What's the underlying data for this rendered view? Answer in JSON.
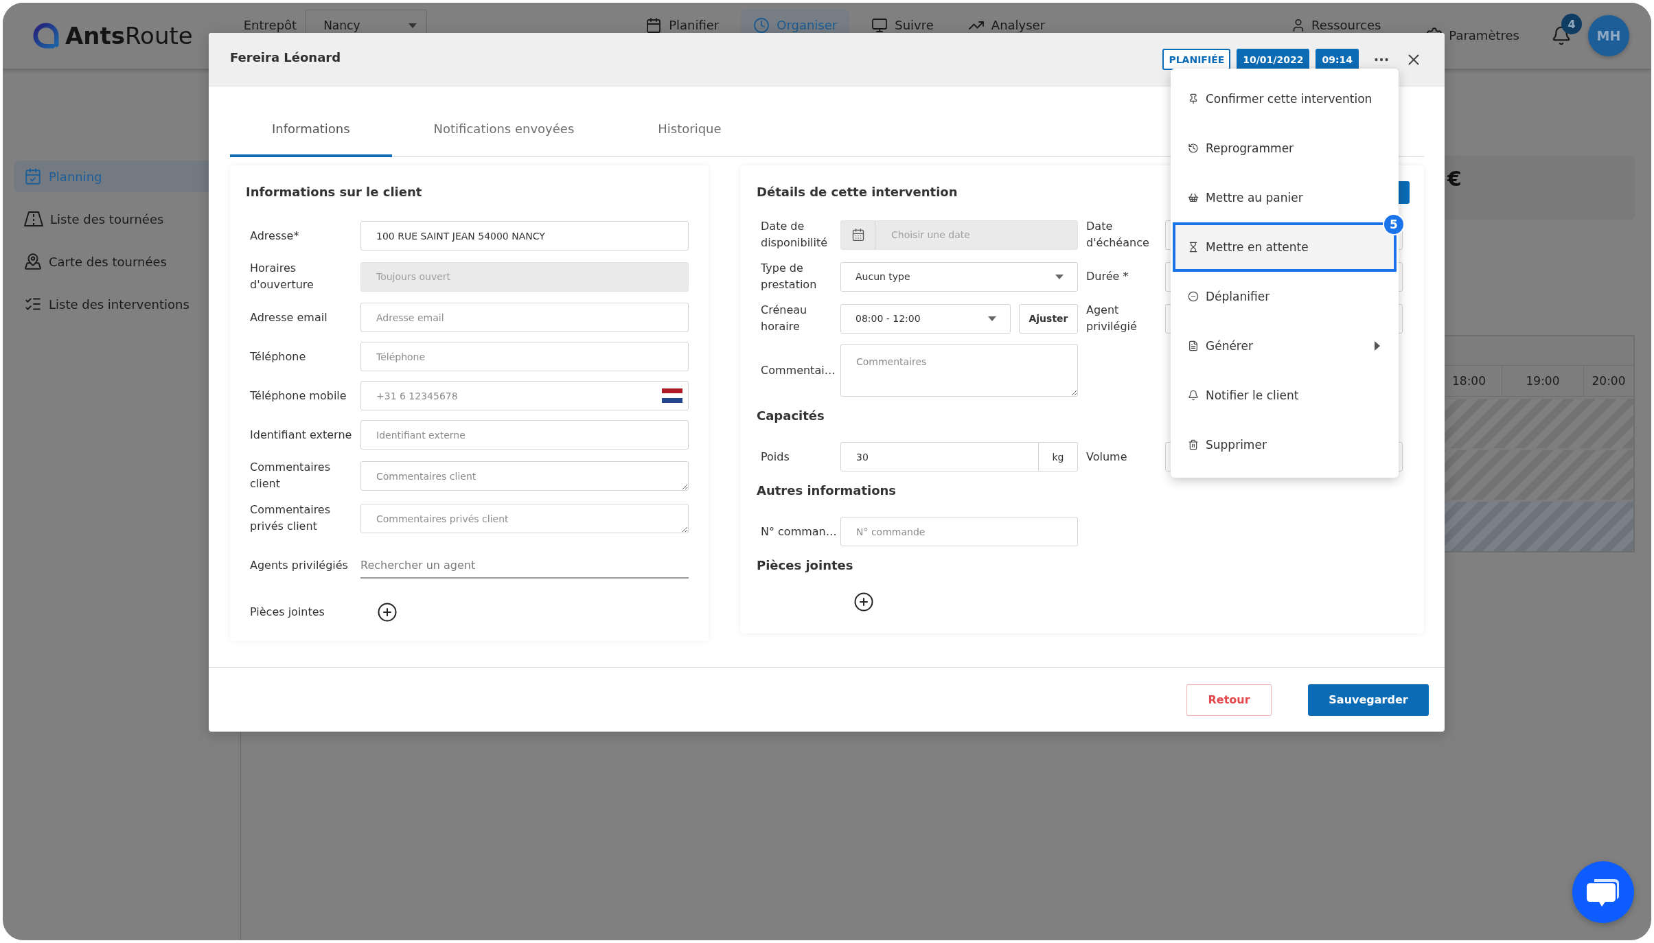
{
  "header": {
    "logo": "**Ants**Route",
    "warehouse_label": "Entrepôt",
    "warehouse_value": "Nancy",
    "nav": [
      {
        "label": "Planifier",
        "selected": false
      },
      {
        "label": "Organiser",
        "selected": true
      },
      {
        "label": "Suivre",
        "selected": false
      },
      {
        "label": "Analyser",
        "selected": false
      }
    ],
    "resources": "Ressources",
    "settings": "Paramètres",
    "notification_count": "4",
    "avatar": "MH"
  },
  "sidebar": {
    "items": [
      {
        "label": "Planning",
        "selected": true
      },
      {
        "label": "Liste des tournées",
        "selected": false
      },
      {
        "label": "Carte des tournées",
        "selected": false
      },
      {
        "label": "Liste des interventions",
        "selected": false
      }
    ]
  },
  "main": {
    "summary_card": {
      "currency": "€"
    },
    "timeline": {
      "hours": [
        "18:00",
        "19:00",
        "20:00"
      ]
    }
  },
  "dialog": {
    "title": "Fereira Léonard",
    "status": "PLANIFIÉE",
    "date": "10/01/2022",
    "time": "09:14",
    "tabs": [
      {
        "label": "Informations",
        "selected": true
      },
      {
        "label": "Notifications envoyées",
        "selected": false
      },
      {
        "label": "Historique",
        "selected": false
      }
    ],
    "client_card": {
      "title": "Informations sur le client",
      "fields": [
        {
          "kind": "input",
          "label": "Adresse*",
          "value": "100 RUE SAINT JEAN 54000 NANCY",
          "disabled": false
        },
        {
          "kind": "input",
          "label": "Horaires d'ouverture",
          "placeholder": "Toujours ouvert",
          "disabled": true
        },
        {
          "kind": "input",
          "label": "Adresse email",
          "placeholder": "Adresse email",
          "disabled": false
        },
        {
          "kind": "input",
          "label": "Téléphone",
          "placeholder": "Téléphone",
          "disabled": false
        },
        {
          "kind": "phone",
          "label": "Téléphone mobile",
          "placeholder": "+31 6 12345678",
          "disabled": false
        },
        {
          "kind": "input",
          "label": "Identifiant externe",
          "placeholder": "Identifiant externe",
          "disabled": false
        },
        {
          "kind": "textarea",
          "label": "Commentaires client",
          "placeholder": "Commentaires client",
          "disabled": false
        },
        {
          "kind": "textarea",
          "label": "Commentaires privés client",
          "placeholder": "Commentaires privés client",
          "disabled": false
        },
        {
          "kind": "search",
          "label": "Agents privilégiés",
          "placeholder": "Rechercher un agent",
          "disabled": false
        },
        {
          "kind": "attachment",
          "label": "Pièces jointes",
          "disabled": false
        }
      ]
    },
    "details_card": {
      "sections": [
        {
          "title": "Détails de cette intervention",
          "action_button": true,
          "rows": [
            {
              "kind": "date",
              "label": "Date de disponibilité",
              "placeholder": "Choisir une date",
              "disabled": true,
              "side_label": "Date d'échéance"
            },
            {
              "kind": "select",
              "label": "Type de prestation",
              "value": "Aucun type",
              "disabled": false,
              "side_label": "Durée *"
            },
            {
              "kind": "select_button",
              "label": "Créneau horaire",
              "value": "08:00 - 12:00",
              "button": "Ajuster",
              "disabled": false,
              "side_label": "Agent privilégié"
            },
            {
              "kind": "textarea",
              "label": "Commentai…",
              "placeholder": "Commentaires",
              "disabled": false
            }
          ]
        },
        {
          "title": "Capacités",
          "action_button": false,
          "rows": [
            {
              "kind": "unit",
              "label": "Poids",
              "value": "30",
              "unit": "kg",
              "disabled": false,
              "side_label": "Volume"
            }
          ]
        },
        {
          "title": "Autres informations",
          "action_button": false,
          "rows": [
            {
              "kind": "input",
              "label": "N° comman…",
              "placeholder": "N° commande",
              "disabled": false
            }
          ]
        },
        {
          "title": "Pièces jointes",
          "action_button": false,
          "rows": [
            {
              "kind": "attachment",
              "disabled": false
            }
          ]
        }
      ]
    },
    "footer_buttons": [
      {
        "label": "Retour",
        "kind": "secondary"
      },
      {
        "label": "Sauvegarder",
        "kind": "primary"
      }
    ]
  },
  "actions_menu": {
    "step_marker": "5",
    "items": [
      {
        "label": "Confirmer cette intervention",
        "selected": false,
        "submenu": false
      },
      {
        "label": "Reprogrammer",
        "selected": false,
        "submenu": false
      },
      {
        "label": "Mettre au panier",
        "selected": false,
        "submenu": false
      },
      {
        "label": "Mettre en attente",
        "selected": true,
        "submenu": false
      },
      {
        "label": "Déplanifier",
        "selected": false,
        "submenu": false
      },
      {
        "label": "Générer",
        "selected": false,
        "submenu": true
      },
      {
        "label": "Notifier le client",
        "selected": false,
        "submenu": false
      },
      {
        "label": "Supprimer",
        "selected": false,
        "submenu": false
      }
    ]
  }
}
